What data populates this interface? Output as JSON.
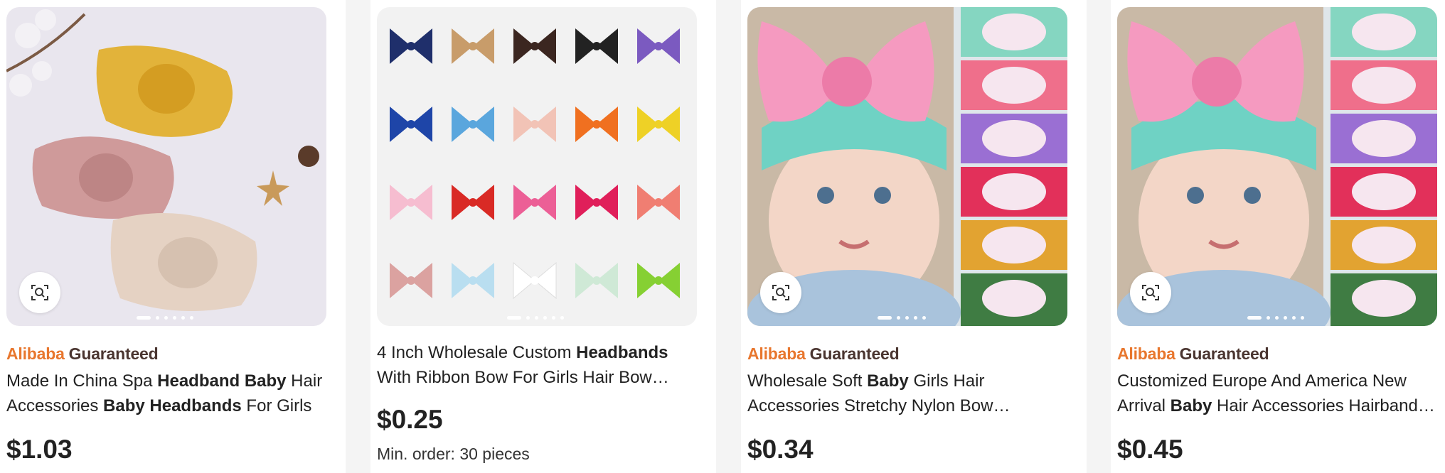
{
  "products": [
    {
      "guaranteed": true,
      "badge": {
        "brand": "Alibaba",
        "word": "Guaranteed"
      },
      "title_parts": [
        {
          "text": "Made In China Spa ",
          "bold": false
        },
        {
          "text": "Headband Baby",
          "bold": true
        },
        {
          "text": " Hair Accessories ",
          "bold": false
        },
        {
          "text": "Baby Headbands",
          "bold": true
        },
        {
          "text": " For Girls",
          "bold": false
        }
      ],
      "price": "$1.03",
      "min_order": "",
      "image_icon": "cable-knit-bow-headbands-image"
    },
    {
      "guaranteed": false,
      "badge": {
        "brand": "",
        "word": ""
      },
      "title_parts": [
        {
          "text": "4 Inch Wholesale Custom ",
          "bold": false
        },
        {
          "text": "Headbands",
          "bold": true
        },
        {
          "text": " With Ribbon Bow For Girls Hair Bow Hairbands",
          "bold": false
        }
      ],
      "price": "$0.25",
      "min_order": "Min. order: 30 pieces",
      "image_icon": "ribbon-bow-headbands-grid-image"
    },
    {
      "guaranteed": true,
      "badge": {
        "brand": "Alibaba",
        "word": "Guaranteed"
      },
      "title_parts": [
        {
          "text": "Wholesale Soft ",
          "bold": false
        },
        {
          "text": "Baby",
          "bold": true
        },
        {
          "text": " Girls Hair Accessories Stretchy Nylon Bow Headbands",
          "bold": false
        }
      ],
      "price": "$0.34",
      "min_order": "",
      "image_icon": "baby-floral-bow-headband-image"
    },
    {
      "guaranteed": true,
      "badge": {
        "brand": "Alibaba",
        "word": "Guaranteed"
      },
      "title_parts": [
        {
          "text": "Customized Europe And America New Arrival ",
          "bold": false
        },
        {
          "text": "Baby",
          "bold": true
        },
        {
          "text": " Hair Accessories Hairbands Set",
          "bold": false
        }
      ],
      "price": "$0.45",
      "min_order": "",
      "image_icon": "baby-floral-bow-headband-image"
    }
  ],
  "carousel": {
    "count": 6,
    "active_index": 0
  },
  "icons": {
    "image_search": "image-search-icon"
  },
  "colors": {
    "alibaba_orange": "#e8772e",
    "guaranteed_brown": "#4a3530",
    "text": "#222222"
  }
}
